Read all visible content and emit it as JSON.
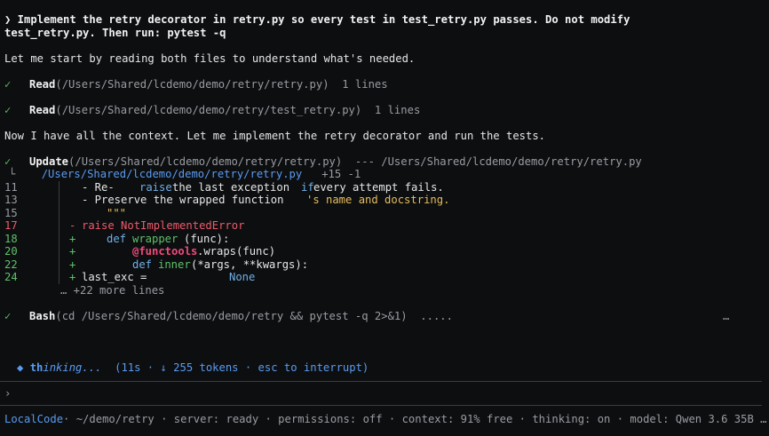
{
  "prompt": {
    "glyph": "❯",
    "line1": " Implement the retry decorator in retry.py so every test in test_retry.py passes. Do not modify",
    "line2": "test_retry.py. Then run: pytest -q"
  },
  "messages": {
    "intro": "Let me start by reading both files to understand what's needed.",
    "context": "Now I have all the context. Let me implement the retry decorator and run the tests."
  },
  "tools": {
    "check": "✓",
    "read1": {
      "name": "Read",
      "args": "(/Users/Shared/lcdemo/demo/retry/retry.py)",
      "meta": "1 lines"
    },
    "read2": {
      "name": "Read",
      "args": "(/Users/Shared/lcdemo/demo/retry/test_retry.py)",
      "meta": "1 lines"
    },
    "update": {
      "name": "Update",
      "args": "(/Users/Shared/lcdemo/demo/retry/retry.py)",
      "arrow": "--- /Users/Shared/lcdemo/demo/retry/retry.py",
      "corner": "└",
      "file": "/Users/Shared/lcdemo/demo/retry/retry.py",
      "stats": "+15 -1"
    },
    "bash": {
      "name": "Bash",
      "args": "(cd /Users/Shared/lcdemo/demo/retry && pytest -q 2>&1)",
      "dots": ".....",
      "ellipsis": "…"
    }
  },
  "diff": {
    "lines": [
      {
        "num": "11",
        "sign": " ",
        "a": "- Re-",
        "b": "raise",
        "c": "the last exception",
        "d": "if",
        "e": "every attempt fails."
      },
      {
        "num": "13",
        "sign": " ",
        "a": "- Preserve the wrapped function",
        "b": "'s name and docstring."
      },
      {
        "num": "15",
        "sign": " ",
        "a": "\"\"\""
      },
      {
        "num": "17",
        "sign": "-",
        "a": "raise NotImplementedError"
      },
      {
        "num": "18",
        "sign": "+",
        "a": "def",
        "b": "wrapper",
        "c": "(func):"
      },
      {
        "num": "20",
        "sign": "+",
        "a": "@functools",
        "b": ".wraps(func)"
      },
      {
        "num": "22",
        "sign": "+",
        "a": "def",
        "b": "inner",
        "c": "(*args, **kwargs):"
      },
      {
        "num": "24",
        "sign": "+",
        "a": "last_exc =",
        "b": "None"
      }
    ],
    "more": "… +22 more lines"
  },
  "status": {
    "glyph": "◆",
    "word_bold": "th",
    "word_rest": "inking...",
    "detail": "(11s · ↓ 255 tokens · esc to interrupt)"
  },
  "input": {
    "prompt": "›"
  },
  "footer": {
    "app": "LocalCode",
    "rest": "· ~/demo/retry · server: ready · permissions: off · context: 91% free · thinking: on · model: Qwen 3.6 35B …"
  },
  "colors": {
    "bg": "#0d0e10",
    "removed": "#ef5a6a",
    "added": "#5fc06a",
    "accent": "#5a9bf0"
  }
}
